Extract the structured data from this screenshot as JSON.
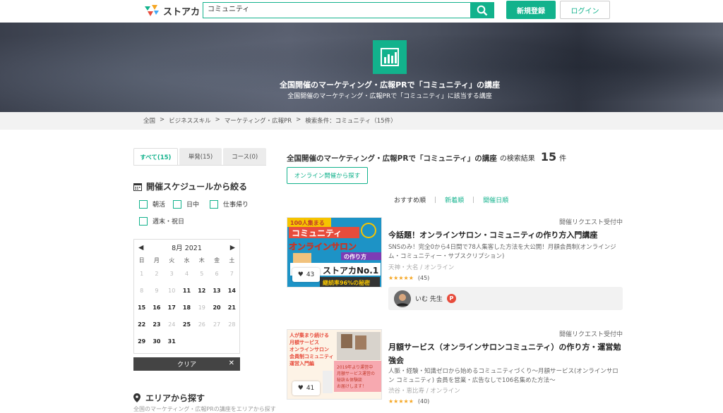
{
  "app": {
    "logo_text": "ストアカ"
  },
  "search": {
    "value": "コミュニティ"
  },
  "header": {
    "register": "新規登録",
    "login": "ログイン"
  },
  "hero": {
    "title": "全国開催のマーケティング・広報PRで「コミュニティ」の講座",
    "subtitle": "全国開催のマーケティング・広報PRで「コミュニティ」に該当する講座"
  },
  "breadcrumb": [
    "全国",
    ">",
    "ビジネススキル",
    ">",
    "マーケティング・広報PR",
    ">",
    "検索条件：コミュニティ（15件）"
  ],
  "tabs": [
    {
      "label": "すべて(15)",
      "active": true
    },
    {
      "label": "単発(15)",
      "active": false
    },
    {
      "label": "コース(0)",
      "active": false
    }
  ],
  "schedule": {
    "heading": "開催スケジュールから絞る",
    "options": [
      "朝活",
      "日中",
      "仕事帰り",
      "週末・祝日"
    ]
  },
  "calendar": {
    "month": "8月 2021",
    "dow": [
      "日",
      "月",
      "火",
      "水",
      "木",
      "金",
      "土"
    ],
    "days": [
      {
        "d": "1",
        "on": false
      },
      {
        "d": "2",
        "on": false
      },
      {
        "d": "3",
        "on": false
      },
      {
        "d": "4",
        "on": false
      },
      {
        "d": "5",
        "on": false
      },
      {
        "d": "6",
        "on": false
      },
      {
        "d": "7",
        "on": false
      },
      {
        "d": "8",
        "on": false
      },
      {
        "d": "9",
        "on": false
      },
      {
        "d": "10",
        "on": false
      },
      {
        "d": "11",
        "on": true
      },
      {
        "d": "12",
        "on": true
      },
      {
        "d": "13",
        "on": true
      },
      {
        "d": "14",
        "on": true
      },
      {
        "d": "15",
        "on": true
      },
      {
        "d": "16",
        "on": true
      },
      {
        "d": "17",
        "on": true
      },
      {
        "d": "18",
        "on": true
      },
      {
        "d": "19",
        "on": false
      },
      {
        "d": "20",
        "on": true
      },
      {
        "d": "21",
        "on": true
      },
      {
        "d": "22",
        "on": true
      },
      {
        "d": "23",
        "on": true
      },
      {
        "d": "24",
        "on": false
      },
      {
        "d": "25",
        "on": true
      },
      {
        "d": "26",
        "on": false
      },
      {
        "d": "27",
        "on": false
      },
      {
        "d": "28",
        "on": false
      },
      {
        "d": "29",
        "on": true
      },
      {
        "d": "30",
        "on": true
      },
      {
        "d": "31",
        "on": true
      }
    ],
    "clear": "クリア"
  },
  "area": {
    "heading": "エリアから探す",
    "sub": "全国のマーケティング・広報PRの講座をエリアから探す"
  },
  "results": {
    "title": "全国開催のマーケティング・広報PRで「コミュニティ」の講座",
    "suffix": "の検索結果",
    "count": "15",
    "unit": "件",
    "online_button": "オンライン開催から探す",
    "sorts": [
      {
        "label": "おすすめ順",
        "current": true
      },
      {
        "label": "新着順",
        "current": false
      },
      {
        "label": "開催日順",
        "current": false
      }
    ]
  },
  "cards": [
    {
      "status": "開催リクエスト受付中",
      "title": "今話題！オンラインサロン・コミュニティの作り方入門講座",
      "desc": "SNSのみ！完全0から4日間で78人集客した方法を大公開！月額会員制(オンラインジム・コミュニティー・サブスクリプション)",
      "location": "天神・大名 / オンライン",
      "stars": "★★★★★",
      "reviews": "(45)",
      "likes": "43",
      "teacher": "いむ 先生",
      "badge": "P"
    },
    {
      "status": "開催リクエスト受付中",
      "title": "月額サービス（オンラインサロンコミュニティ）の作り方・運営勉強会",
      "desc": "人脈・経験・知識ゼロから始めるコミュニティづくり〜月額サービス(オンラインサロン コミュニティ) 会員を営業・広告なしで106名集めた方法〜",
      "location": "渋谷・恵比寿 / オンライン",
      "stars": "★★★★★",
      "reviews": "(40)",
      "likes": "41"
    }
  ],
  "thumb1": {
    "l1": "100人集まる",
    "l2": "コミュニティ",
    "l3": "オンラインサロン",
    "l4": "の作り方",
    "l5": "ストアカNo.1",
    "l6": "継続率96%の秘密"
  },
  "thumb2": {
    "l1": "人が集まり続ける",
    "l2": "月額サービス",
    "l3": "オンラインサロン",
    "l4": "会員制コミュニティ",
    "l5": "運営入門編",
    "l6": "2019年より運営中",
    "l7": "月額サービス運営の",
    "l8": "秘訣＆体験談",
    "l9": "お届けします！"
  }
}
